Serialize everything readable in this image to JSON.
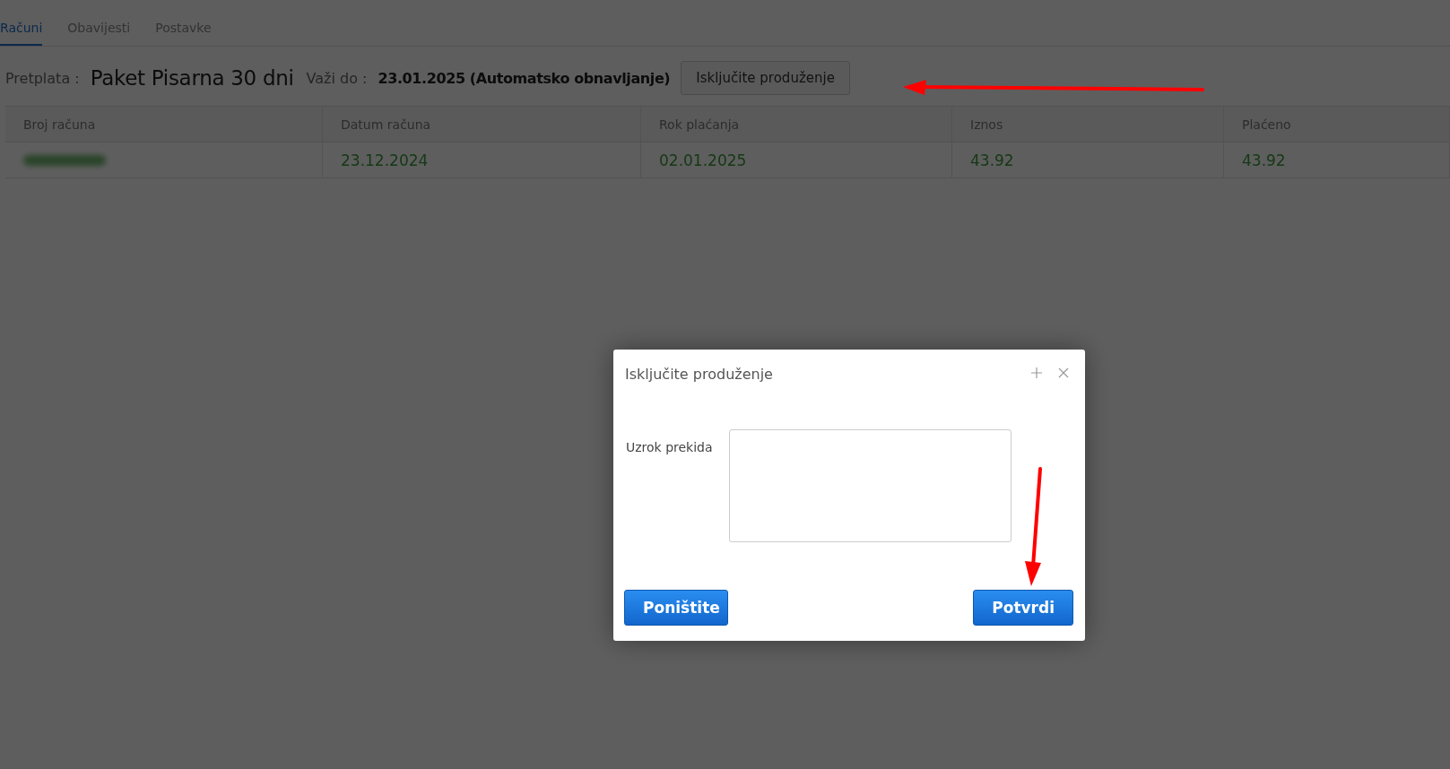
{
  "tabs": [
    {
      "label": "Računi",
      "selected": true
    },
    {
      "label": "Obavijesti",
      "selected": false
    },
    {
      "label": "Postavke",
      "selected": false
    }
  ],
  "subscription": {
    "label": "Pretplata :",
    "plan": "Paket Pisarna 30 dni",
    "valid_label": "Važi do :",
    "valid_value": "23.01.2025 (Automatsko obnavljanje)",
    "button": "Isključite produženje"
  },
  "table": {
    "columns": [
      "Broj računa",
      "Datum računa",
      "Rok plaćanja",
      "Iznos",
      "Plaćeno"
    ],
    "rows": [
      {
        "redacted": true,
        "cells": [
          "",
          "23.12.2024",
          "02.01.2025",
          "43.92",
          "43.92"
        ]
      }
    ]
  },
  "dialog": {
    "title": "Isključite produženje",
    "field_label": "Uzrok prekida",
    "buttons": [
      "Poništite",
      "Potvrdi"
    ]
  }
}
